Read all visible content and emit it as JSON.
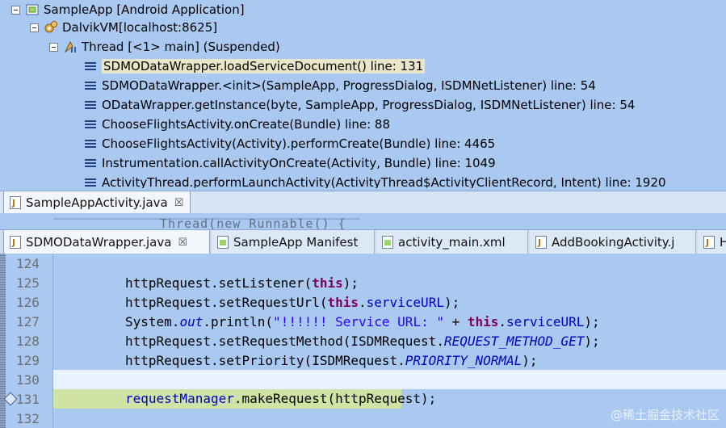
{
  "debug_tree": {
    "app_label": "SampleApp [Android Application]",
    "vm_label": "DalvikVM[localhost:8625]",
    "thread_label": "Thread [<1> main] (Suspended)",
    "frames": [
      "SDMODataWrapper.loadServiceDocument() line: 131",
      "SDMODataWrapper.<init>(SampleApp, ProgressDialog, ISDMNetListener) line: 54",
      "ODataWrapper.getInstance(byte, SampleApp, ProgressDialog, ISDMNetListener) line: 54",
      "ChooseFlightsActivity.onCreate(Bundle) line: 88",
      "ChooseFlightsActivity(Activity).performCreate(Bundle) line: 4465",
      "Instrumentation.callActivityOnCreate(Activity, Bundle) line: 1049",
      "ActivityThread.performLaunchActivity(ActivityThread$ActivityClientRecord, Intent) line: 1920"
    ]
  },
  "top_editor": {
    "tab_label": "SampleAppActivity.java",
    "close_glyph": "☒",
    "stub_text": "Thread(new Runnable() {"
  },
  "editor_tabs": [
    {
      "label": "SDMODataWrapper.java",
      "close": "☒"
    },
    {
      "label": "SampleApp Manifest"
    },
    {
      "label": "activity_main.xml"
    },
    {
      "label": "AddBookingActivity.j"
    },
    {
      "label": "H"
    }
  ],
  "code_lines": [
    {
      "num": "124"
    },
    {
      "num": "125",
      "parts": [
        [
          "",
          "httpRequest.setListener("
        ],
        [
          "kw",
          "this"
        ],
        [
          "",
          ");"
        ]
      ]
    },
    {
      "num": "126",
      "parts": [
        [
          "",
          "httpRequest.setRequestUrl("
        ],
        [
          "kw",
          "this"
        ],
        [
          "",
          "."
        ],
        [
          "fld",
          "serviceURL"
        ],
        [
          "",
          ");"
        ]
      ]
    },
    {
      "num": "127",
      "parts": [
        [
          "",
          "System."
        ],
        [
          "sfld",
          "out"
        ],
        [
          "",
          ".println("
        ],
        [
          "str",
          "\"!!!!!! Service URL: \""
        ],
        [
          "",
          " + "
        ],
        [
          "kw",
          "this"
        ],
        [
          "",
          "."
        ],
        [
          "fld",
          "serviceURL"
        ],
        [
          "",
          ");"
        ]
      ]
    },
    {
      "num": "128",
      "parts": [
        [
          "",
          "httpRequest.setRequestMethod(ISDMRequest."
        ],
        [
          "sfld",
          "REQUEST_METHOD_GET"
        ],
        [
          "",
          ");"
        ]
      ]
    },
    {
      "num": "129",
      "parts": [
        [
          "",
          "httpRequest.setPriority(ISDMRequest."
        ],
        [
          "sfld",
          "PRIORITY_NORMAL"
        ],
        [
          "",
          ");"
        ]
      ]
    },
    {
      "num": "130"
    },
    {
      "num": "131",
      "parts": [
        [
          "fld",
          "requestManager"
        ],
        [
          "",
          ".makeRequest(httpRequest);"
        ]
      ]
    },
    {
      "num": "132"
    }
  ],
  "watermark": "@稀土掘金技术社区",
  "colors": {
    "debug_bg": "#a9c9f1",
    "frame_highlight": "#ebe6c7",
    "current_line": "#e8f2fe",
    "exec_line": "#cfe3a5",
    "keyword": "#7f0055",
    "field": "#0000c0",
    "string": "#2a00ff"
  }
}
